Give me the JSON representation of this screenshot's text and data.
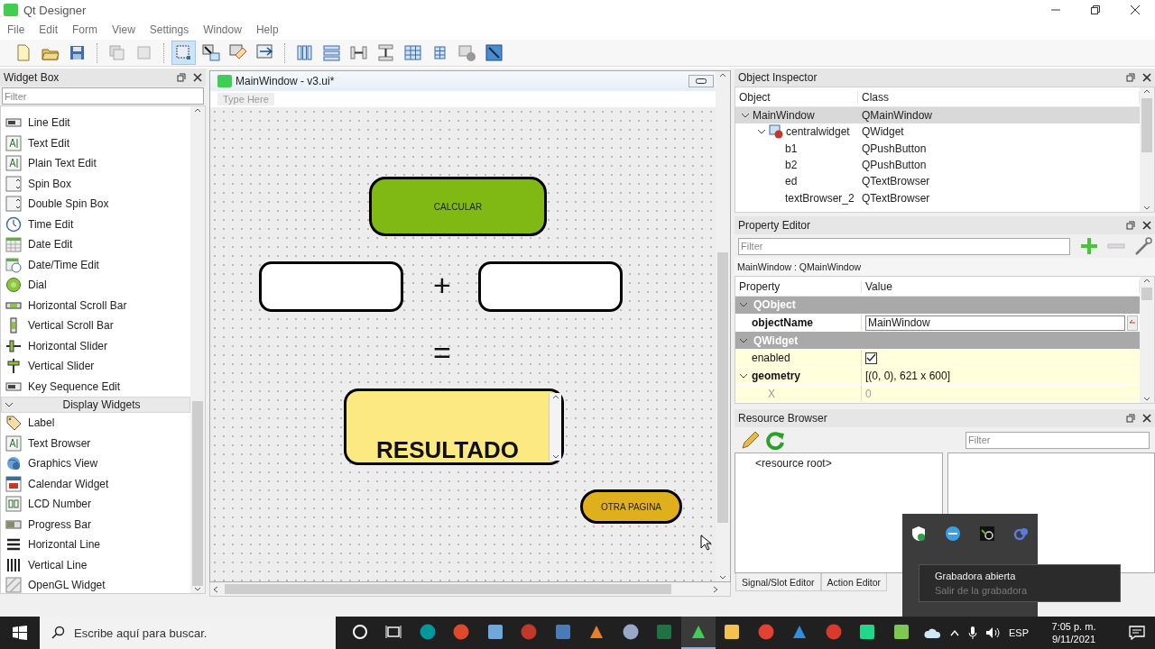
{
  "window": {
    "title": "Qt Designer"
  },
  "menu": [
    "File",
    "Edit",
    "Form",
    "View",
    "Settings",
    "Window",
    "Help"
  ],
  "edit_modes": [
    {
      "selected": true
    },
    {
      "selected": false
    },
    {
      "selected": false
    },
    {
      "selected": false
    }
  ],
  "widget_box": {
    "title": "Widget Box",
    "filter_placeholder": "Filter",
    "input_items": [
      "Line Edit",
      "Text Edit",
      "Plain Text Edit",
      "Spin Box",
      "Double Spin Box",
      "Time Edit",
      "Date Edit",
      "Date/Time Edit",
      "Dial",
      "Horizontal Scroll Bar",
      "Vertical Scroll Bar",
      "Horizontal Slider",
      "Vertical Slider",
      "Key Sequence Edit"
    ],
    "display_group": {
      "title": "Display Widgets",
      "expanded": true,
      "items": [
        "Label",
        "Text Browser",
        "Graphics View",
        "Calendar Widget",
        "LCD Number",
        "Progress Bar",
        "Horizontal Line",
        "Vertical Line",
        "OpenGL Widget"
      ]
    }
  },
  "form_window": {
    "title": "MainWindow - v3.ui*",
    "menu_placeholder": "Type Here",
    "widgets": [
      {
        "kind": "button",
        "text": "CALCULAR",
        "color": "#80b814"
      },
      {
        "kind": "input"
      },
      {
        "kind": "label",
        "text": "+"
      },
      {
        "kind": "input"
      },
      {
        "kind": "label",
        "text": "="
      },
      {
        "kind": "browser",
        "text": "RESULTADO",
        "color": "#fce981"
      },
      {
        "kind": "button",
        "text": "OTRA PAGINA",
        "color": "#e0b01c"
      }
    ]
  },
  "object_inspector": {
    "title": "Object Inspector",
    "columns": [
      "Object",
      "Class"
    ],
    "tree": [
      {
        "name": "MainWindow",
        "class": "QMainWindow",
        "selected": true,
        "expanded": true,
        "children": [
          {
            "name": "centralwidget",
            "class": "QWidget",
            "selected": false,
            "expanded": true,
            "children": [
              {
                "name": "b1",
                "class": "QPushButton",
                "selected": false
              },
              {
                "name": "b2",
                "class": "QPushButton",
                "selected": false
              },
              {
                "name": "ed",
                "class": "QTextBrowser",
                "selected": false
              },
              {
                "name": "textBrowser_2",
                "class": "QTextBrowser",
                "selected": false
              }
            ]
          }
        ]
      }
    ]
  },
  "property_editor": {
    "title": "Property Editor",
    "filter_placeholder": "Filter",
    "context": "MainWindow : QMainWindow",
    "columns": [
      "Property",
      "Value"
    ],
    "groups": [
      {
        "name": "QObject",
        "expanded": true,
        "properties": [
          {
            "kind": "text",
            "name": "objectName",
            "value": "MainWindow",
            "modified": true,
            "editing": true,
            "disabled": false
          }
        ]
      },
      {
        "name": "QWidget",
        "expanded": true,
        "properties": [
          {
            "kind": "checkbox",
            "name": "enabled",
            "checked": true,
            "modified": false,
            "disabled": false
          },
          {
            "kind": "text",
            "name": "geometry",
            "value": "[(0, 0), 621 x 600]",
            "modified": true,
            "disabled": false,
            "expanded": true,
            "children": [
              {
                "name": "X",
                "value": "0",
                "modified": false,
                "disabled": true
              }
            ]
          }
        ]
      }
    ]
  },
  "resource_browser": {
    "title": "Resource Browser",
    "filter_placeholder": "Filter",
    "root": "<resource root>"
  },
  "bottom_tabs": [
    "Signal/Slot Editor",
    "Action Editor"
  ],
  "tray_tooltip": {
    "items": [
      {
        "label": "Grabadora abierta",
        "disabled": false
      },
      {
        "label": "Salir de la grabadora",
        "disabled": true
      }
    ]
  },
  "taskbar": {
    "search_placeholder": "Escribe aquí para buscar.",
    "language": "ESP",
    "time": "7:05 p. m.",
    "date": "9/11/2021",
    "apps": [
      {
        "selected": false
      },
      {
        "selected": false
      },
      {
        "selected": false
      },
      {
        "selected": false
      },
      {
        "selected": false
      },
      {
        "selected": false
      },
      {
        "selected": false
      },
      {
        "selected": false
      },
      {
        "selected": true
      },
      {
        "selected": false
      },
      {
        "selected": false
      },
      {
        "selected": false
      },
      {
        "selected": false
      },
      {
        "selected": false
      },
      {
        "selected": false
      }
    ]
  }
}
